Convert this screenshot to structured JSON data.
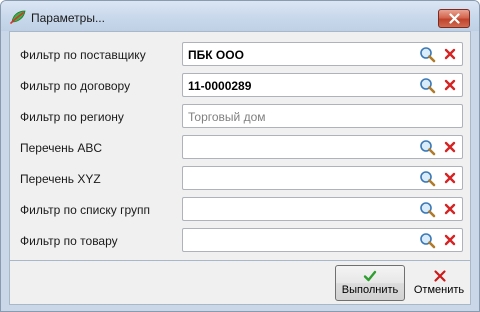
{
  "window": {
    "title": "Параметры..."
  },
  "filters": [
    {
      "label": "Фильтр по поставщику",
      "value": "ПБК ООО",
      "placeholder": ""
    },
    {
      "label": "Фильтр по договору",
      "value": "11-0000289",
      "placeholder": ""
    },
    {
      "label": "Фильтр по региону",
      "value": "",
      "placeholder": "Торговый дом"
    },
    {
      "label": "Перечень ABC",
      "value": "",
      "placeholder": ""
    },
    {
      "label": "Перечень XYZ",
      "value": "",
      "placeholder": ""
    },
    {
      "label": "Фильтр по списку групп",
      "value": "",
      "placeholder": ""
    },
    {
      "label": "Фильтр по товару",
      "value": "",
      "placeholder": ""
    }
  ],
  "buttons": {
    "ok_label": "Выполнить",
    "cancel_label": "Отменить"
  },
  "icons": {
    "app": "app-leaf-icon",
    "close": "close-icon",
    "search": "magnifier-icon",
    "clear": "red-x-icon",
    "ok": "green-checkmark-icon",
    "cancel": "red-cross-icon"
  },
  "colors": {
    "titlebar": "#cad9ec",
    "client_bg": "#f0f0f0",
    "close_button": "#c0432c",
    "ok_check": "#2e9e2e",
    "cancel_cross": "#cc1a1a",
    "placeholder_text": "#808080"
  }
}
